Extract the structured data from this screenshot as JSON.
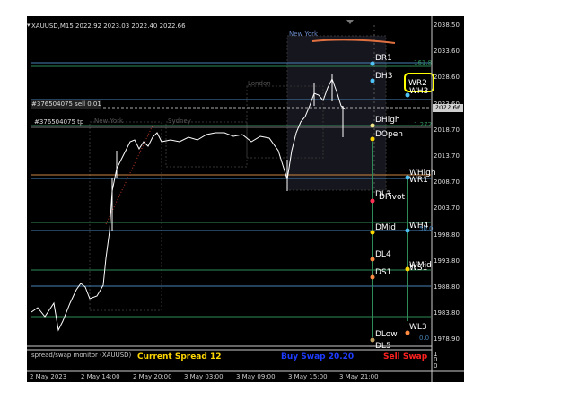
{
  "header": {
    "symbol_line": "XAUUSD,M15  2022.92 2023.03 2022.40 2022.66"
  },
  "sessions": {
    "new_york_top": "New York",
    "london": "London",
    "new_york_left": "New York",
    "sydney": "Sydney"
  },
  "levels": {
    "DR1": "DR1",
    "DH3": "DH3",
    "DHigh": "DHigh",
    "DOpen": "DOpen",
    "DPivot": "DPivot",
    "DL3": "DL3",
    "DMid": "DMid",
    "DL4": "DL4",
    "DS1": "DS1",
    "DLow": "DLow",
    "DL5": "DL5",
    "WR2": "WR2",
    "WH3": "WH3",
    "WHigh": "WHigh",
    "WR1": "WR1",
    "WH4": "WH4",
    "WMid": "WMid",
    "WS1": "WS1",
    "WL3": "WL3"
  },
  "fib": {
    "f1618": "161.8",
    "f1272": "1.272",
    "f00": "0.0",
    "f50": "50.0"
  },
  "trades": {
    "sell_label": "#376504075 sell 0.01",
    "tp_label": "#376504075 tp"
  },
  "y_axis": [
    "2038.50",
    "2033.60",
    "2028.60",
    "2023.60",
    "2018.70",
    "2013.70",
    "2008.70",
    "2003.70",
    "1998.80",
    "1993.80",
    "1988.80",
    "1983.80",
    "1978.90"
  ],
  "current_price": "2022.66",
  "subwindow": {
    "title": "spread/swap monitor (XAUUSD)",
    "spread": "Current Spread 12",
    "buy_swap": "Buy Swap 20.20",
    "sell_swap": "Sell Swap",
    "axis_top": "1",
    "axis_mid": "0",
    "axis_bottom": "0"
  },
  "x_axis": [
    "2 May 2023",
    "2 May 14:00",
    "2 May 20:00",
    "3 May 03:00",
    "3 May 09:00",
    "3 May 15:00",
    "3 May 21:00"
  ],
  "colors": {
    "bg": "#000000",
    "candle": "#ffffff",
    "green_line": "#2e8b57",
    "blue_line": "#4682b4",
    "yellow": "#ffd700",
    "spread_text": "#ffd700",
    "buy_text": "#1e3cff",
    "sell_text": "#ff2020"
  }
}
